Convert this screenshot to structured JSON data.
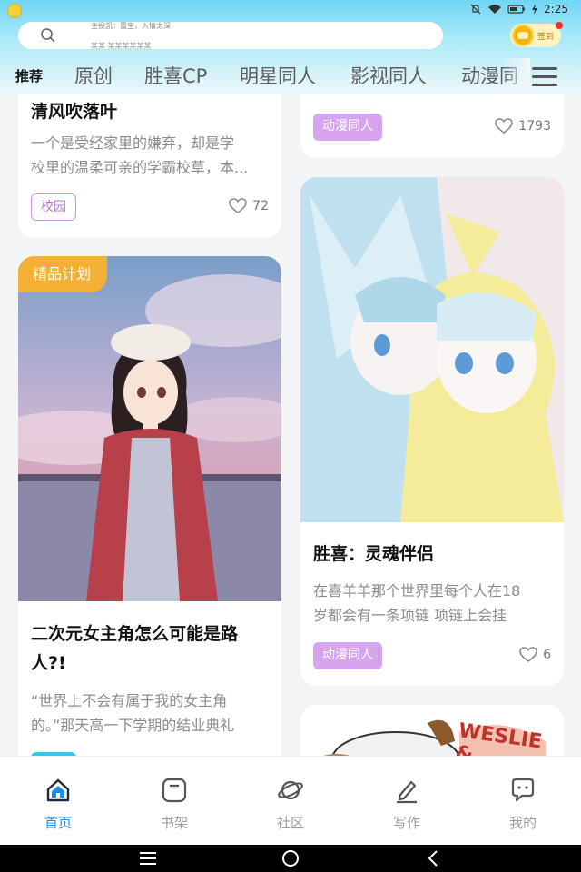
{
  "status_bar": {
    "time": "2:25"
  },
  "search": {
    "hint_line1": "主役凯：重生，入情太深",
    "hint_line2": "某某·某某某某某某"
  },
  "signin": {
    "label": "签到"
  },
  "tabs": [
    {
      "label": "推荐",
      "active": true
    },
    {
      "label": "原创",
      "active": false
    },
    {
      "label": "胜喜CP",
      "active": false
    },
    {
      "label": "明星同人",
      "active": false
    },
    {
      "label": "影视同人",
      "active": false
    },
    {
      "label": "动漫同",
      "active": false
    }
  ],
  "cards": [
    {
      "title": "清风吹落叶",
      "desc_line1": "一个是受经家里的嫌弃，却是学",
      "desc_line2": "校里的温柔可亲的学霸校草，本...",
      "tag": "校园",
      "likes": "72"
    },
    {
      "tag": "动漫同人",
      "likes": "1793"
    },
    {
      "badge": "精品计划",
      "title_line1": "二次元女主角怎么可能是路",
      "title_line2": "人?!",
      "desc_line1": "“世界上不会有属于我的女主角",
      "desc_line2": "的。”那天高一下学期的结业典礼"
    },
    {
      "title": "胜喜：灵魂伴侣",
      "desc_line1": "在喜羊羊那个世界里每个人在18",
      "desc_line2": "岁都会有一条项链 项链上会挂",
      "tag": "动漫同人",
      "likes": "6"
    },
    {
      "cover_text": "WESLIE &"
    }
  ],
  "bottom_nav": [
    {
      "label": "首页",
      "icon": "home-icon",
      "active": true
    },
    {
      "label": "书架",
      "icon": "bookshelf-icon",
      "active": false
    },
    {
      "label": "社区",
      "icon": "planet-icon",
      "active": false
    },
    {
      "label": "写作",
      "icon": "pen-icon",
      "active": false
    },
    {
      "label": "我的",
      "icon": "chat-icon",
      "active": false
    }
  ],
  "colors": {
    "accent": "#1a8ff0",
    "tag_purple": "#d7a4f0",
    "badge_orange": "#f4b035"
  }
}
